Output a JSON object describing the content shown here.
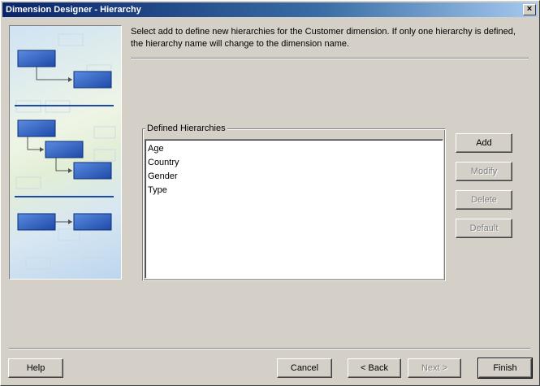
{
  "window": {
    "title": "Dimension Designer - Hierarchy",
    "close_glyph": "×"
  },
  "instructions": "Select add to define new hierarchies for the Customer dimension. If only one hierarchy is defined, the hierarchy name will change to the dimension name.",
  "hierarchies": {
    "group_label": "Defined Hierarchies",
    "items": [
      "Age",
      "Country",
      "Gender",
      "Type"
    ]
  },
  "side_buttons": {
    "add": "Add",
    "modify": "Modify",
    "delete": "Delete",
    "default": "Default"
  },
  "footer": {
    "help": "Help",
    "cancel": "Cancel",
    "back": "< Back",
    "next": "Next >",
    "finish": "Finish"
  },
  "colors": {
    "title_start": "#0a246a",
    "title_end": "#a6caf0",
    "face": "#d4d0c8",
    "diagram_box": "#2f5fb8"
  }
}
